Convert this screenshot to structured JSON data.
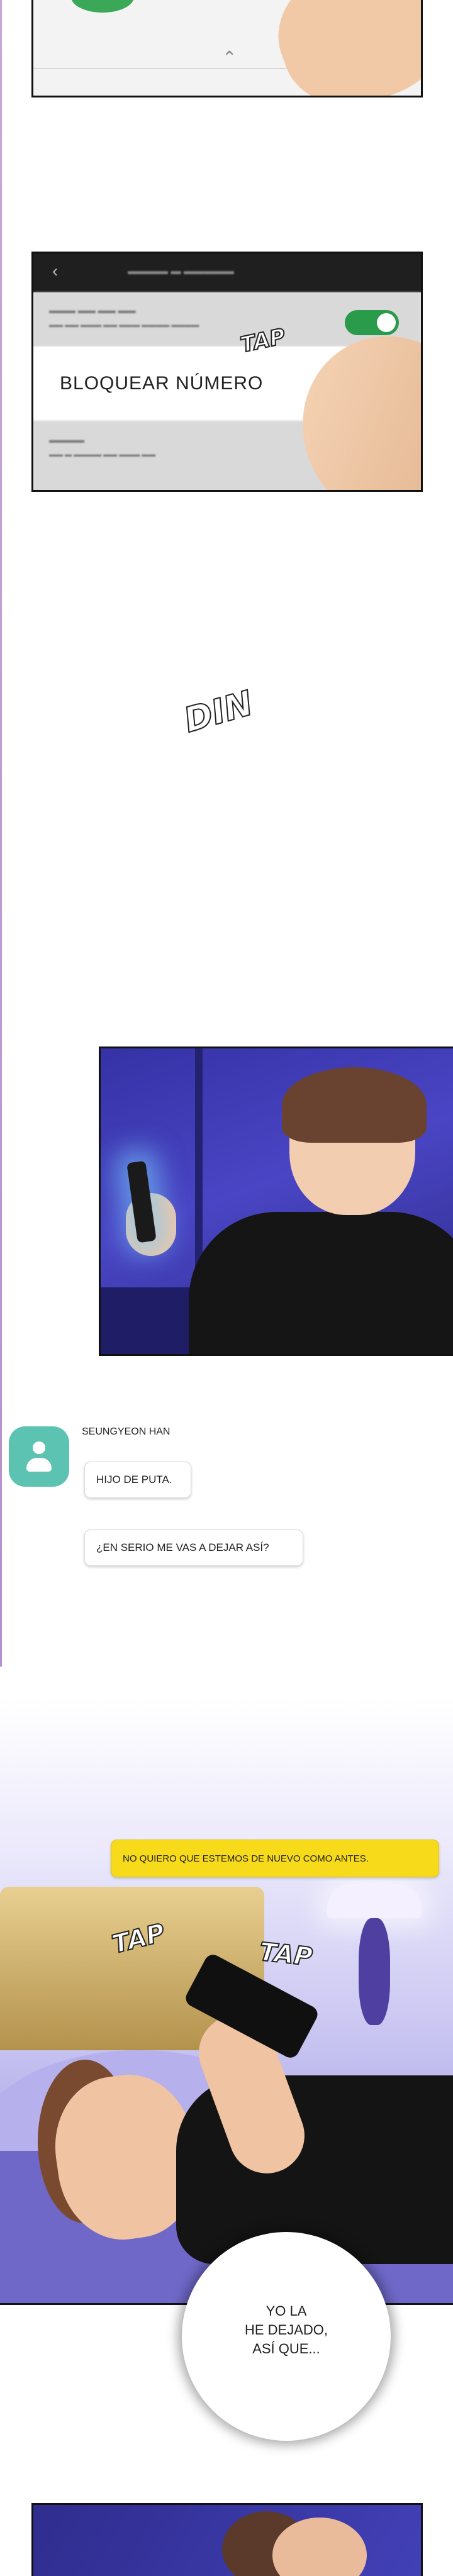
{
  "sfx": {
    "tap": "TAP",
    "din": "DIN"
  },
  "settings_panel": {
    "block_number_label": "BLOQUEAR NÚMERO"
  },
  "chat": {
    "sender_name": "SEUNGYEON HAN",
    "messages": [
      "HIJO DE PUTA.",
      "¿EN SERIO ME VAS A DEJAR ASÍ?"
    ],
    "reply": "NO QUIERO QUE ESTEMOS DE NUEVO COMO ANTES."
  },
  "narration": {
    "burst_text": "YO LA\nHE DEJADO,\nASÍ QUE..."
  },
  "colors": {
    "toggle_on": "#2a9b4a",
    "avatar_bg": "#5cc3b2",
    "reply_bubble": "#f7da19",
    "night_blue": "#3532a6"
  }
}
